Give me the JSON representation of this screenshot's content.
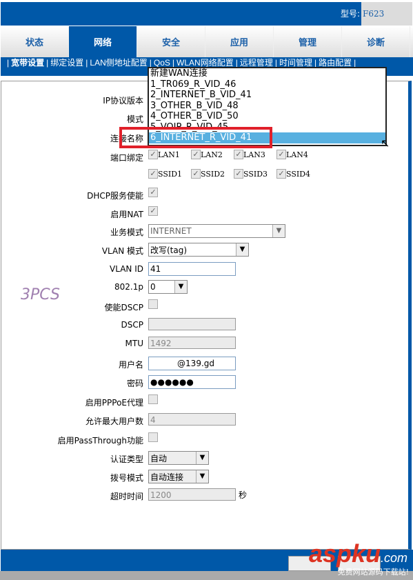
{
  "header": {
    "model_label": "型号:",
    "model_value": "F623"
  },
  "tabs": [
    {
      "label": "状态"
    },
    {
      "label": "网络",
      "active": true
    },
    {
      "label": "安全"
    },
    {
      "label": "应用"
    },
    {
      "label": "管理"
    },
    {
      "label": "诊断"
    }
  ],
  "subnav": [
    "宽带设置",
    "绑定设置",
    "LAN侧地址配置",
    "QoS",
    "WLAN网络配置",
    "远程管理",
    "时间管理",
    "路由配置"
  ],
  "form": {
    "ip_version": "IP协议版本",
    "mode": "模式",
    "conn_name": "连接名称",
    "port_bind": "端口绑定",
    "ports": [
      "LAN1",
      "LAN2",
      "LAN3",
      "LAN4"
    ],
    "ssids": [
      "SSID1",
      "SSID2",
      "SSID3",
      "SSID4"
    ],
    "dhcp": "DHCP服务使能",
    "nat": "启用NAT",
    "service_mode": "业务模式",
    "service_mode_value": "INTERNET",
    "vlan_mode": "VLAN 模式",
    "vlan_mode_value": "改写(tag)",
    "vlan_id": "VLAN ID",
    "vlan_id_value": "41",
    "p8021": "802.1p",
    "p8021_value": "0",
    "dscp_enable": "使能DSCP",
    "dscp": "DSCP",
    "mtu": "MTU",
    "mtu_value": "1492",
    "username": "用户名",
    "username_value": "@139.gd",
    "password": "密码",
    "password_value": "●●●●●●",
    "pppoe_proxy": "启用PPPoE代理",
    "max_users": "允许最大用户数",
    "max_users_value": "4",
    "passthrough": "启用PassThrough功能",
    "auth_type": "认证类型",
    "auth_type_value": "自动",
    "dial_mode": "拨号模式",
    "dial_mode_value": "自动连接",
    "timeout": "超时时间",
    "timeout_value": "1200",
    "timeout_unit": "秒"
  },
  "dropdown": {
    "options": [
      "新建WAN连接",
      "1_TR069_R_VID_46",
      "2_INTERNET_B_VID_41",
      "3_OTHER_B_VID_48",
      "4_OTHER_B_VID_50",
      "5_VOIP_R_VID_45",
      "6_INTERNET_R_VID_41"
    ],
    "selected_index": 6
  },
  "watermark": {
    "brand": "aspku",
    ".com": ".com",
    "slogan": "免费网站源码下载站!",
    "logo": "3PCS"
  },
  "colors": {
    "primary": "#0058a8",
    "highlight": "#58b0e0",
    "annotation": "#e0202a"
  }
}
